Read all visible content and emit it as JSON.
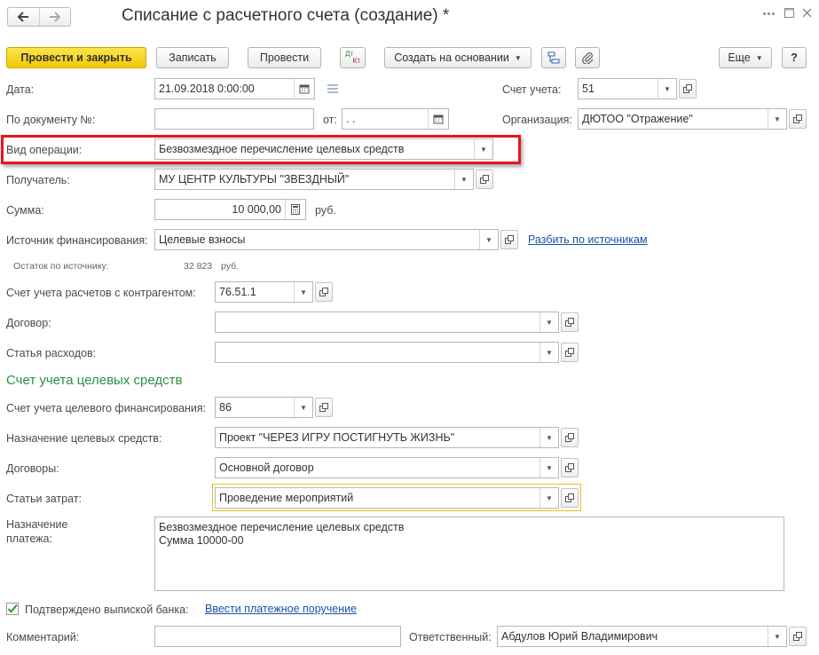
{
  "title": "Списание с расчетного счета (создание) *",
  "nav": {
    "back_icon": "arrow-left-icon",
    "forward_icon": "arrow-right-icon"
  },
  "header_icons": {
    "menu": "more-dots-icon",
    "maximize": "maximize-icon",
    "close": "close-icon"
  },
  "toolbar": {
    "post_close": "Провести и закрыть",
    "save": "Записать",
    "post": "Провести",
    "dtkt_dt": "Дт",
    "dtkt_kt": "Кт",
    "create_based": "Создать на основании",
    "more": "Еще",
    "help": "?"
  },
  "fields": {
    "date": {
      "label": "Дата:",
      "value": "21.09.2018  0:00:00"
    },
    "account": {
      "label": "Счет учета:",
      "value": "51"
    },
    "doc_number": {
      "label": "По документу №:",
      "value": ""
    },
    "doc_from": {
      "label": "от:",
      "value": " .  .    "
    },
    "organization": {
      "label": "Организация:",
      "value": "ДЮТОО \"Отражение\""
    },
    "operation": {
      "label": "Вид операции:",
      "value": "Безвозмездное перечисление целевых средств"
    },
    "recipient": {
      "label": "Получатель:",
      "value": "МУ ЦЕНТР КУЛЬТУРЫ \"ЗВЕЗДНЫЙ\""
    },
    "amount": {
      "label": "Сумма:",
      "value": "10 000,00",
      "unit": "руб."
    },
    "funding_source": {
      "label": "Источник финансирования:",
      "value": "Целевые взносы",
      "link": "Разбить по источникам"
    },
    "balance": {
      "label": "Остаток по источнику:",
      "value": "32 823",
      "unit": "руб."
    },
    "settlement_account": {
      "label": "Счет учета расчетов с контрагентом:",
      "value": "76.51.1"
    },
    "contract": {
      "label": "Договор:",
      "value": ""
    },
    "expense_item": {
      "label": "Статья расходов:",
      "value": ""
    }
  },
  "target_section": {
    "heading": "Счет учета целевых средств",
    "account": {
      "label": "Счет учета целевого финансирования:",
      "value": "86"
    },
    "purpose": {
      "label": "Назначение целевых средств:",
      "value": "Проект \"ЧЕРЕЗ ИГРУ ПОСТИГНУТЬ ЖИЗНЬ\""
    },
    "contracts": {
      "label": "Договоры:",
      "value": "Основной договор"
    },
    "cost_items": {
      "label": "Статьи затрат:",
      "value": "Проведение мероприятий"
    }
  },
  "payment_purpose": {
    "label_line1": "Назначение",
    "label_line2": "платежа:",
    "line1": "Безвозмездное перечисление целевых средств",
    "line2": "Сумма 10000-00"
  },
  "confirmed": {
    "label": "Подтверждено выпиской банка:",
    "checked": true,
    "link": "Ввести платежное поручение"
  },
  "comment": {
    "label": "Комментарий:",
    "value": ""
  },
  "responsible": {
    "label": "Ответственный:",
    "value": "Абдулов Юрий Владимирович"
  },
  "colors": {
    "primary_button": "#f5d000",
    "highlight_box": "#e8141c",
    "section_heading": "#2a9046",
    "link": "#1a50a8",
    "focused_field": "#e8c020"
  }
}
